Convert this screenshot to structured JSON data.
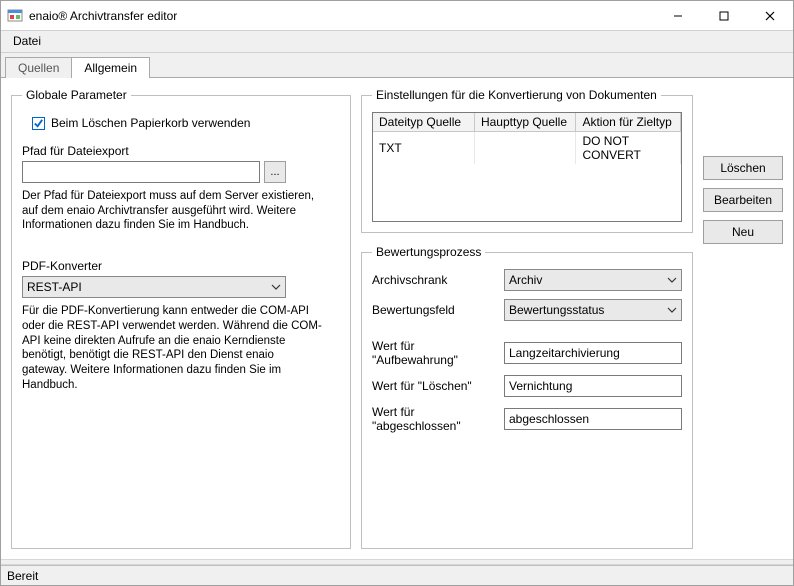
{
  "window": {
    "title": "enaio® Archivtransfer editor"
  },
  "menu": {
    "datei": "Datei"
  },
  "tabs": {
    "quellen": "Quellen",
    "allgemein": "Allgemein"
  },
  "globale": {
    "legend": "Globale Parameter",
    "chk_papierkorb": "Beim Löschen Papierkorb verwenden",
    "pfad_label": "Pfad für Dateiexport",
    "pfad_value": "",
    "browse_label": "...",
    "pfad_help": "Der Pfad für Dateiexport muss auf dem Server existieren, auf dem enaio Archivtransfer ausgeführt wird. Weitere Informationen dazu finden Sie im Handbuch.",
    "pdf_label": "PDF-Konverter",
    "pdf_value": "REST-API",
    "pdf_help": "Für die PDF-Konvertierung kann entweder die COM-API oder die REST-API verwendet werden. Während die COM-API keine direkten Aufrufe an die enaio Kerndienste benötigt, benötigt die REST-API den Dienst enaio gateway. Weitere Informationen dazu finden Sie im Handbuch."
  },
  "konvert": {
    "legend": "Einstellungen für die Konvertierung von Dokumenten",
    "cols": {
      "c1": "Dateityp Quelle",
      "c2": "Haupttyp Quelle",
      "c3": "Aktion für Zieltyp"
    },
    "rows": [
      {
        "c1": "TXT",
        "c2": "",
        "c3": "DO NOT CONVERT"
      }
    ]
  },
  "buttons": {
    "loeschen": "Löschen",
    "bearbeiten": "Bearbeiten",
    "neu": "Neu"
  },
  "bewertung": {
    "legend": "Bewertungsprozess",
    "archivschrank_lbl": "Archivschrank",
    "archivschrank_val": "Archiv",
    "bewertungsfeld_lbl": "Bewertungsfeld",
    "bewertungsfeld_val": "Bewertungsstatus",
    "wert_aufbewahrung_lbl": "Wert für \"Aufbewahrung\"",
    "wert_aufbewahrung_val": "Langzeitarchivierung",
    "wert_loeschen_lbl": "Wert für \"Löschen\"",
    "wert_loeschen_val": "Vernichtung",
    "wert_abgeschlossen_lbl": "Wert für \"abgeschlossen\"",
    "wert_abgeschlossen_val": "abgeschlossen"
  },
  "status": {
    "text": "Bereit"
  },
  "colors": {
    "accent": "#0066cc"
  }
}
